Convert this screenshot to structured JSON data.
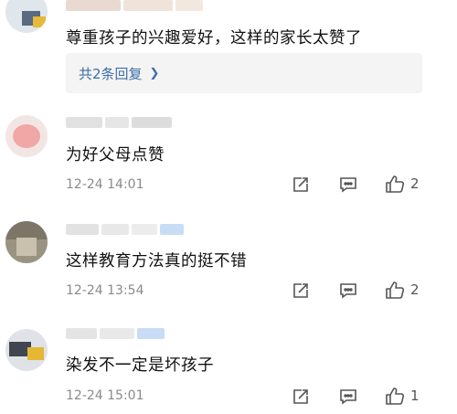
{
  "comments": [
    {
      "text": "尊重孩子的兴趣爱好，这样的家长太赞了",
      "replies_label": "共2条回复"
    },
    {
      "text": "为好父母点赞",
      "timestamp": "12-24 14:01",
      "likes": "2"
    },
    {
      "text": "这样教育方法真的挺不错",
      "timestamp": "12-24 13:54",
      "likes": "2"
    },
    {
      "text": "染发不一定是坏孩子",
      "timestamp": "12-24 15:01",
      "likes": "1"
    }
  ],
  "icons": {
    "share": "share-icon",
    "comment": "comment-icon",
    "like": "thumbs-up-icon",
    "replies_chevron": "chevron-right-icon"
  },
  "colors": {
    "link": "#3b6ea8",
    "meta": "#8a8a8a",
    "reply_bg": "#f4f4f4"
  }
}
